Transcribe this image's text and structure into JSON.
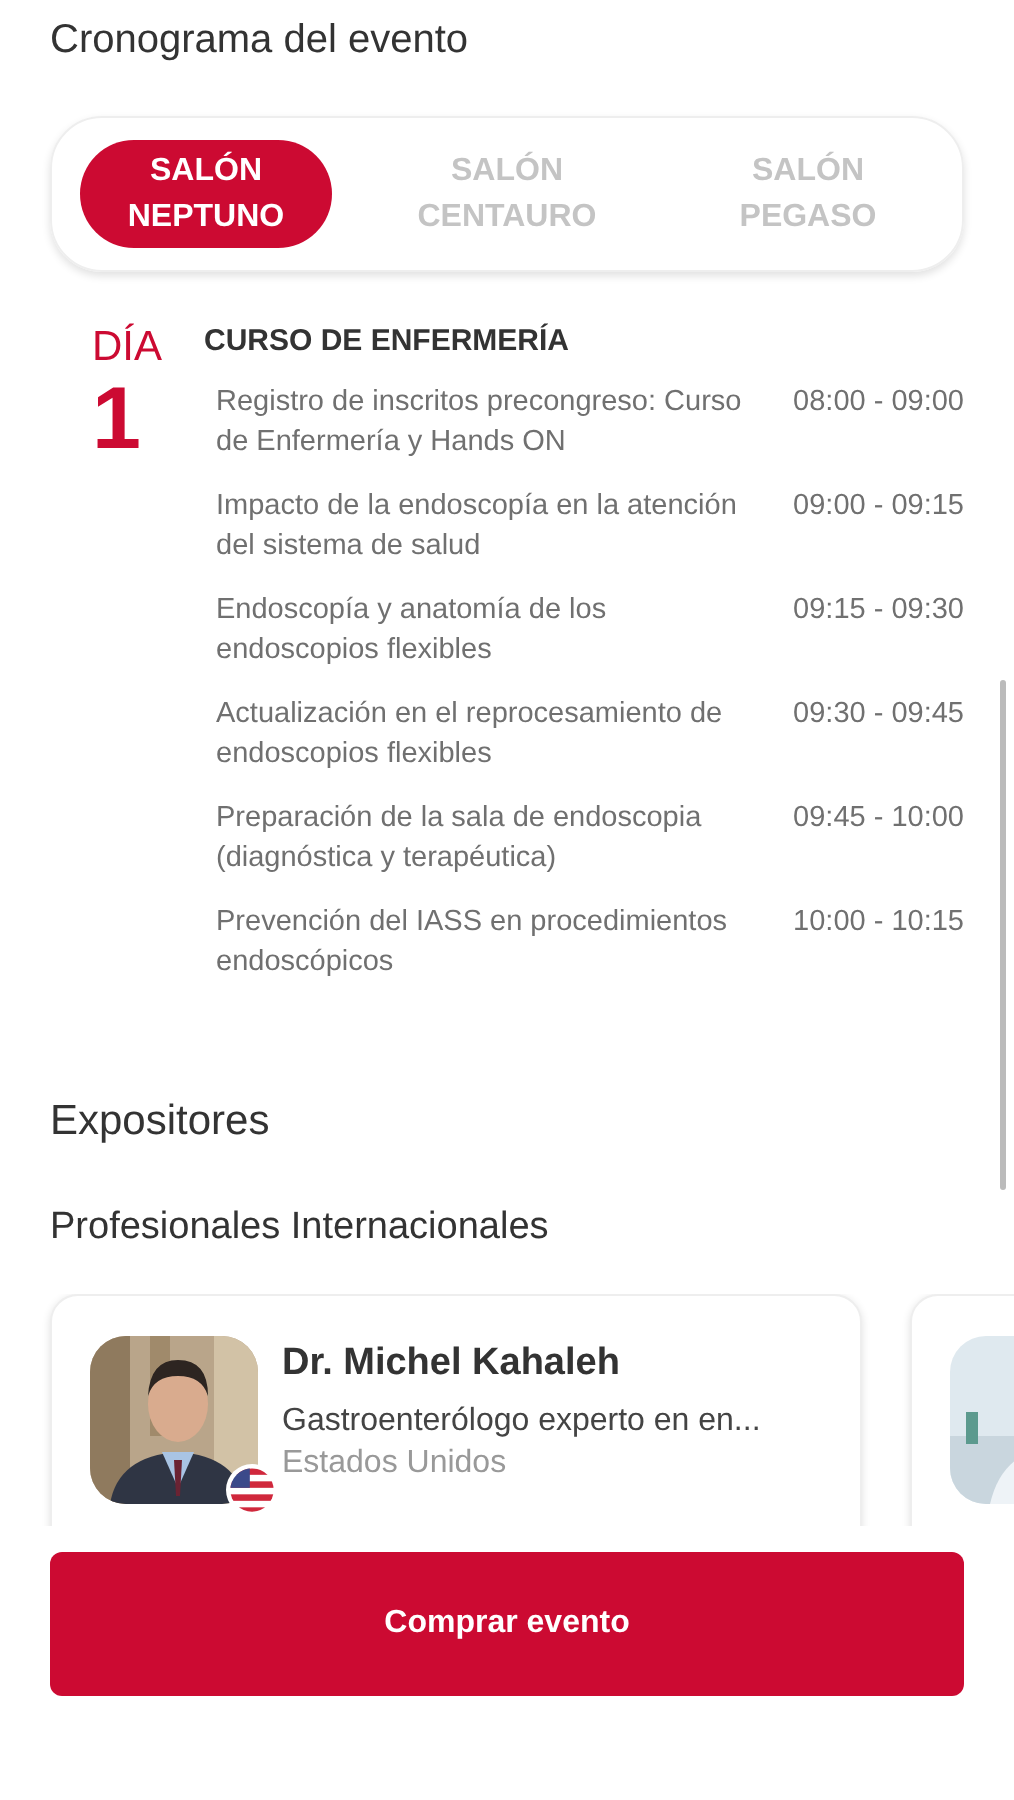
{
  "schedule": {
    "title": "Cronograma del evento",
    "tabs": [
      {
        "line1": "SALÓN",
        "line2": "NEPTUNO",
        "selected": true
      },
      {
        "line1": "SALÓN",
        "line2": "CENTAURO",
        "selected": false
      },
      {
        "line1": "SALÓN",
        "line2": "PEGASO",
        "selected": false
      }
    ],
    "day_label": "DÍA",
    "day_number": "1",
    "course": "CURSO DE ENFERMERÍA",
    "sessions": [
      {
        "topic": "Registro de inscritos precongreso: Curso de Enfermería y Hands ON",
        "time": "08:00 - 09:00"
      },
      {
        "topic": "Impacto de la endoscopía en la atención del sistema de salud",
        "time": "09:00 - 09:15"
      },
      {
        "topic": "Endoscopía y anatomía de los endoscopios flexibles",
        "time": "09:15 - 09:30"
      },
      {
        "topic": "Actualización en el reprocesamiento de endoscopios flexibles",
        "time": "09:30 - 09:45"
      },
      {
        "topic": "Preparación de la sala de endoscopia (diagnóstica y terapéutica)",
        "time": "09:45 - 10:00"
      },
      {
        "topic": "Prevención del IASS en procedimientos endoscópicos",
        "time": "10:00 - 10:15"
      }
    ]
  },
  "exhibitors": {
    "title": "Expositores",
    "subtitle": "Profesionales Internacionales",
    "speakers": [
      {
        "kind": "full",
        "name": "Dr. Michel Kahaleh",
        "specialty": "Gastroenterólogo experto en en...",
        "country": "Estados Unidos"
      },
      {
        "kind": "partial"
      }
    ]
  },
  "buy_button": "Comprar evento"
}
